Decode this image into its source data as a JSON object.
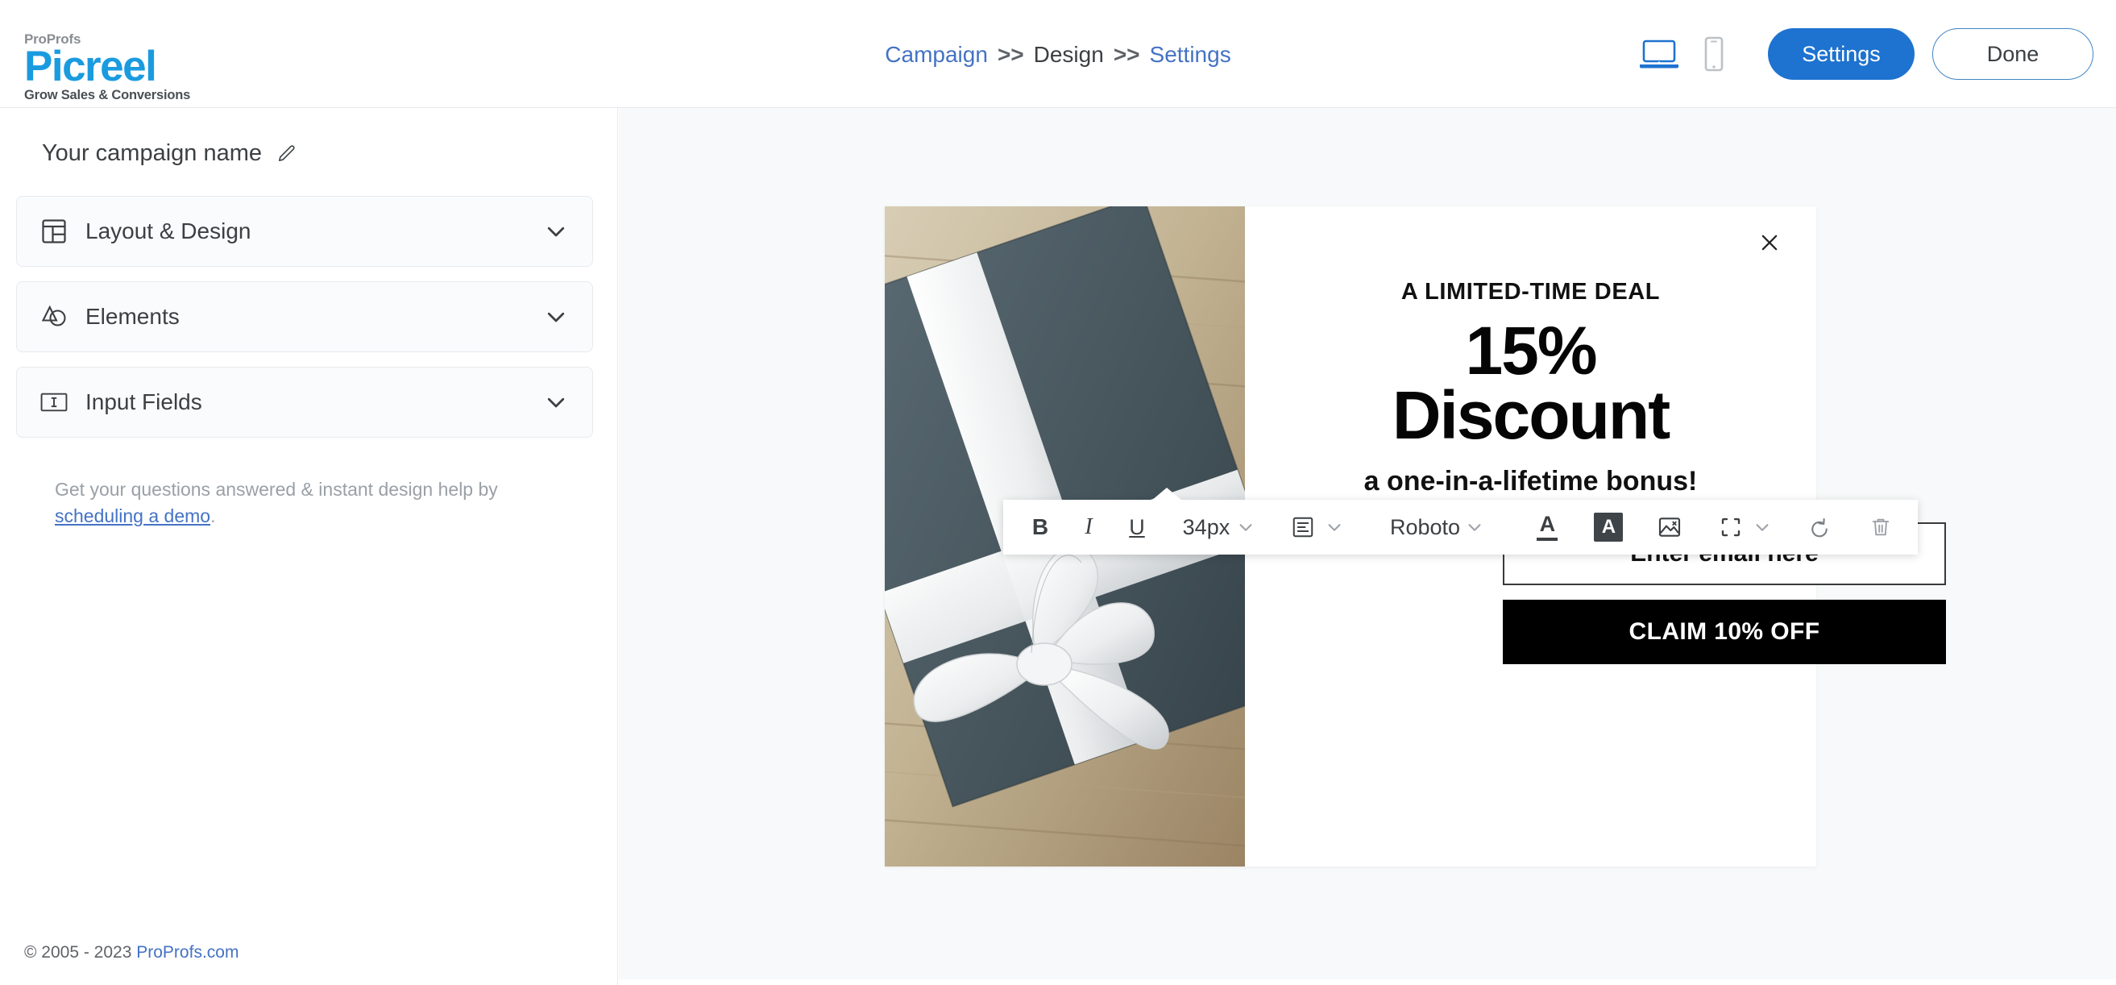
{
  "app": {
    "logo_top": "ProProfs",
    "logo_main": "Picreel",
    "logo_tagline": "Grow Sales & Conversions"
  },
  "breadcrumb": {
    "items": [
      {
        "label": "Campaign",
        "type": "link"
      },
      {
        "label": "Design",
        "type": "current"
      },
      {
        "label": "Settings",
        "type": "link"
      }
    ],
    "separator": ">>"
  },
  "topbar": {
    "device_desktop_icon": "laptop-icon",
    "device_mobile_icon": "mobile-icon",
    "settings_label": "Settings",
    "done_label": "Done",
    "settings_color": "#1e72d0",
    "done_border_color": "#4285c5"
  },
  "sidebar": {
    "campaign_name": "Your campaign name",
    "edit_icon": "pencil-icon",
    "panels": [
      {
        "label": "Layout & Design",
        "icon": "layout-grid-icon"
      },
      {
        "label": "Elements",
        "icon": "shapes-icon"
      },
      {
        "label": "Input Fields",
        "icon": "text-input-icon"
      }
    ],
    "help_text": "Get your questions answered & instant design help by ",
    "help_link": "scheduling a demo",
    "help_suffix": ".",
    "footer_copyright": "© 2005 - 2023 ",
    "footer_link": "ProProfs.com"
  },
  "popup": {
    "close_icon": "close-icon",
    "eyebrow": "A LIMITED-TIME DEAL",
    "headline_line1": "15%",
    "headline_line2": "Discount",
    "subtext": "a one-in-a-lifetime bonus!",
    "email_placeholder": "Enter email here",
    "cta_label": "CLAIM 10% OFF",
    "cta_background": "#000000",
    "image_alt": "gift-box-with-white-ribbon"
  },
  "editor_toolbar": {
    "bold_label": "B",
    "italic_label": "I",
    "underline_label": "U",
    "font_size_value": "34px",
    "align_icon": "text-align-icon",
    "font_family_value": "Roboto",
    "text_color_icon": "text-color-icon",
    "highlight_color_icon": "background-color-icon",
    "insert_image_icon": "insert-image-icon",
    "resize_icon": "resize-frame-icon",
    "undo_icon": "undo-icon",
    "delete_icon": "trash-icon",
    "chevron_icon": "chevron-down-icon"
  }
}
